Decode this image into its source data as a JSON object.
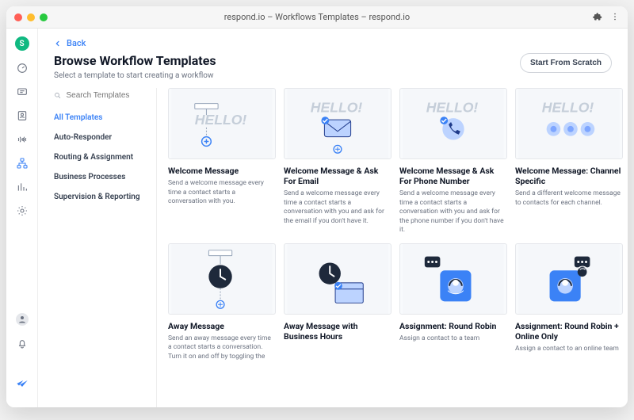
{
  "window": {
    "title": "respond.io – Workflows Templates – respond.io"
  },
  "header": {
    "back_label": "Back",
    "title": "Browse Workflow Templates",
    "subtitle": "Select a template to start creating a workflow",
    "scratch_button": "Start From Scratch"
  },
  "search": {
    "placeholder": "Search Templates"
  },
  "filters": [
    "All Templates",
    "Auto-Responder",
    "Routing & Assignment",
    "Business Processes",
    "Supervision & Reporting"
  ],
  "cards": [
    {
      "title": "Welcome Message",
      "desc": "Send a welcome message every time a contact starts a conversation with you."
    },
    {
      "title": "Welcome Message & Ask For Email",
      "desc": "Send a welcome message every time a contact starts a conversation with you and ask for the email if you don't have it."
    },
    {
      "title": "Welcome Message & Ask For Phone Number",
      "desc": "Send a welcome message every time a contact starts a conversation with you and ask for the phone number if you don't have it."
    },
    {
      "title": "Welcome Message: Channel Specific",
      "desc": "Send a different welcome message to contacts for each channel."
    },
    {
      "title": "Away Message",
      "desc": "Send an away message every time a contact starts a conversation. Turn it on and off by toggling the"
    },
    {
      "title": "Away Message with Business Hours",
      "desc": ""
    },
    {
      "title": "Assignment: Round Robin",
      "desc": "Assign a contact to a team"
    },
    {
      "title": "Assignment: Round Robin + Online Only",
      "desc": "Assign a contact to an online team"
    }
  ],
  "rail_avatar_initial": "S"
}
